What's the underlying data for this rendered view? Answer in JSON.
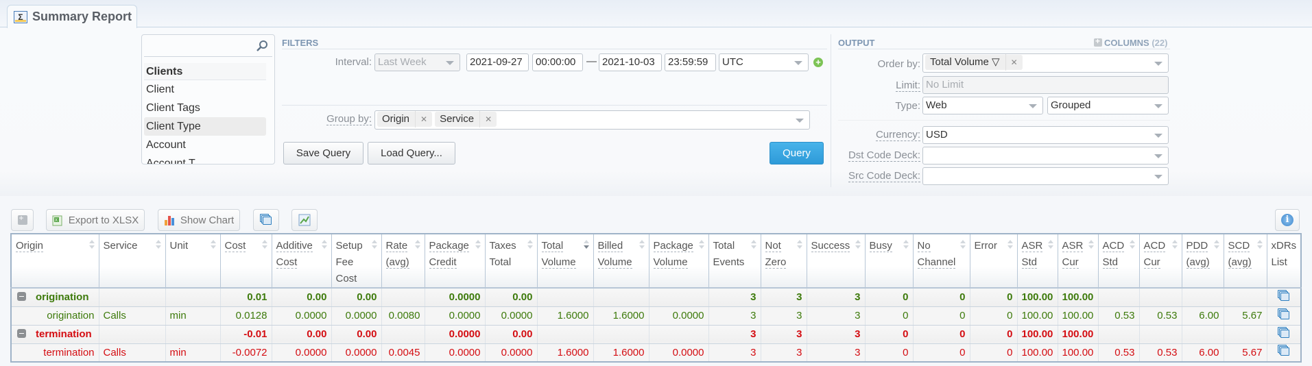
{
  "tab": {
    "title": "Summary Report",
    "icon": "sigma-report-icon"
  },
  "list_panel": {
    "search_placeholder": "",
    "group_header": "Clients",
    "items": [
      "Client",
      "Client Tags",
      "Client Type",
      "Account",
      "Account T..."
    ],
    "selected_index": 2
  },
  "filters": {
    "title": "FILTERS",
    "interval_label": "Interval:",
    "interval_value": "Last Week",
    "start_date": "2021-09-27",
    "start_time": "00:00:00",
    "dash": "—",
    "end_date": "2021-10-03",
    "end_time": "23:59:59",
    "timezone": "UTC",
    "group_by_label": "Group by:",
    "group_by_chips": [
      "Origin",
      "Service"
    ],
    "save_query": "Save Query",
    "load_query": "Load Query...",
    "query": "Query"
  },
  "output": {
    "title": "OUTPUT",
    "columns_label": "COLUMNS",
    "columns_count": "(22)",
    "order_by_label": "Order by:",
    "order_by_chip": "Total Volume ▽",
    "limit_label": "Limit:",
    "limit_placeholder": "No Limit",
    "type_label": "Type:",
    "type_value": "Web",
    "type_mode": "Grouped",
    "currency_label": "Currency:",
    "currency_value": "USD",
    "dst_code_deck_label": "Dst Code Deck:",
    "dst_code_deck_value": "",
    "src_code_deck_label": "Src Code Deck:",
    "src_code_deck_value": ""
  },
  "toolbar": {
    "export_label": "Export to XLSX",
    "chart_label": "Show Chart"
  },
  "table": {
    "columns": [
      {
        "l1": "Origin",
        "l2": "",
        "l3": ""
      },
      {
        "l1": "Service",
        "l2": "",
        "l3": ""
      },
      {
        "l1": "Unit",
        "l2": "",
        "l3": ""
      },
      {
        "l1": "Cost",
        "l2": "",
        "l3": ""
      },
      {
        "l1": "Additive",
        "l2": "Cost",
        "l3": ""
      },
      {
        "l1": "Setup",
        "l2": "Fee",
        "l3": "Cost"
      },
      {
        "l1": "Rate",
        "l2": "(avg)",
        "l3": ""
      },
      {
        "l1": "Package",
        "l2": "Credit",
        "l3": ""
      },
      {
        "l1": "Taxes",
        "l2": "Total",
        "l3": ""
      },
      {
        "l1": "Total",
        "l2": "Volume",
        "l3": ""
      },
      {
        "l1": "Billed",
        "l2": "Volume",
        "l3": ""
      },
      {
        "l1": "Package",
        "l2": "Volume",
        "l3": ""
      },
      {
        "l1": "Total",
        "l2": "Events",
        "l3": ""
      },
      {
        "l1": "Not",
        "l2": "Zero",
        "l3": ""
      },
      {
        "l1": "Success",
        "l2": "",
        "l3": ""
      },
      {
        "l1": "Busy",
        "l2": "",
        "l3": ""
      },
      {
        "l1": "No",
        "l2": "Channel",
        "l3": ""
      },
      {
        "l1": "Error",
        "l2": "",
        "l3": ""
      },
      {
        "l1": "ASR",
        "l2": "Std",
        "l3": ""
      },
      {
        "l1": "ASR",
        "l2": "Cur",
        "l3": ""
      },
      {
        "l1": "ACD",
        "l2": "Std",
        "l3": ""
      },
      {
        "l1": "ACD",
        "l2": "Cur",
        "l3": ""
      },
      {
        "l1": "PDD",
        "l2": "(avg)",
        "l3": ""
      },
      {
        "l1": "SCD",
        "l2": "(avg)",
        "l3": ""
      },
      {
        "l1": "xDRs",
        "l2": "List",
        "l3": ""
      }
    ],
    "sorted_column_index": 9,
    "rows": [
      {
        "type": "group",
        "color": "green",
        "cells": [
          "origination",
          "",
          "",
          "0.01",
          "0.00",
          "0.00",
          "",
          "0.0000",
          "0.00",
          "",
          "",
          "",
          "3",
          "3",
          "3",
          "0",
          "0",
          "0",
          "100.00",
          "100.00",
          "",
          "",
          "",
          ""
        ]
      },
      {
        "type": "detail",
        "color": "green",
        "cells": [
          "origination",
          "Calls",
          "min",
          "0.0128",
          "0.0000",
          "0.0000",
          "0.0080",
          "0.0000",
          "0.0000",
          "1.6000",
          "1.6000",
          "0.0000",
          "3",
          "3",
          "3",
          "0",
          "0",
          "0",
          "100.00",
          "100.00",
          "0.53",
          "0.53",
          "6.00",
          "5.67"
        ]
      },
      {
        "type": "group",
        "color": "red",
        "cells": [
          "termination",
          "",
          "",
          "-0.01",
          "0.00",
          "0.00",
          "",
          "0.0000",
          "0.00",
          "",
          "",
          "",
          "3",
          "3",
          "3",
          "0",
          "0",
          "0",
          "100.00",
          "100.00",
          "",
          "",
          "",
          ""
        ]
      },
      {
        "type": "detail",
        "color": "red",
        "cells": [
          "termination",
          "Calls",
          "min",
          "-0.0072",
          "0.0000",
          "0.0000",
          "0.0045",
          "0.0000",
          "0.0000",
          "1.6000",
          "1.6000",
          "0.0000",
          "3",
          "3",
          "3",
          "0",
          "0",
          "0",
          "100.00",
          "100.00",
          "0.53",
          "0.53",
          "6.00",
          "5.67"
        ]
      }
    ]
  },
  "colors": {
    "positive": "#3d7a0b",
    "negative": "#d40d12",
    "accent": "#2e9ad8"
  }
}
